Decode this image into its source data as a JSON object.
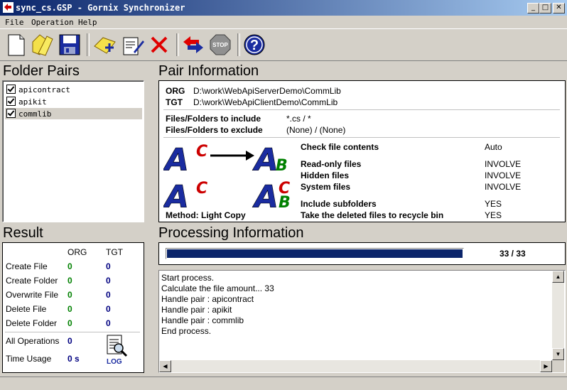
{
  "window": {
    "title": "sync_cs.GSP - Gornix Synchronizer"
  },
  "window_controls": {
    "minimize": "_",
    "maximize": "□",
    "close": "✕"
  },
  "menu": [
    "File",
    "Operation",
    "Help"
  ],
  "toolbar": {
    "icons": [
      "new-file-icon",
      "open-folder-icon",
      "save-icon",
      "add-pair-icon",
      "edit-pair-icon",
      "delete-icon",
      "synchronize-icon",
      "stop-icon",
      "help-icon"
    ],
    "stop_label": "STOP",
    "help_label": "?"
  },
  "folder_pairs": {
    "heading": "Folder Pairs",
    "items": [
      {
        "label": "apicontract",
        "checked": true,
        "selected": false
      },
      {
        "label": "apikit",
        "checked": true,
        "selected": false
      },
      {
        "label": "commlib",
        "checked": true,
        "selected": true
      }
    ]
  },
  "pair_info": {
    "heading": "Pair Information",
    "org_label": "ORG",
    "org_path": "D:\\work\\WebApiServerDemo\\CommLib",
    "tgt_label": "TGT",
    "tgt_path": "D:\\work\\WebApiClientDemo\\CommLib",
    "include_label": "Files/Folders to include",
    "include_value": "*.cs / *",
    "exclude_label": "Files/Folders to exclude",
    "exclude_value": "(None) / (None)",
    "method": "Method: Light Copy",
    "diagram": {
      "a": "A",
      "b": "B",
      "c": "C"
    },
    "options": [
      {
        "label": "Check file contents",
        "value": "Auto"
      },
      {
        "label": "Read-only files",
        "value": "INVOLVE"
      },
      {
        "label": "Hidden files",
        "value": "INVOLVE"
      },
      {
        "label": "System files",
        "value": "INVOLVE"
      },
      {
        "label": "Include subfolders",
        "value": "YES"
      },
      {
        "label": "Take the deleted files to recycle bin",
        "value": "YES"
      }
    ]
  },
  "result": {
    "heading": "Result",
    "col_org": "ORG",
    "col_tgt": "TGT",
    "rows": [
      {
        "label": "Create File",
        "org": "0",
        "tgt": "0"
      },
      {
        "label": "Create Folder",
        "org": "0",
        "tgt": "0"
      },
      {
        "label": "Overwrite File",
        "org": "0",
        "tgt": "0"
      },
      {
        "label": "Delete File",
        "org": "0",
        "tgt": "0"
      },
      {
        "label": "Delete Folder",
        "org": "0",
        "tgt": "0"
      }
    ],
    "all_ops_label": "All Operations",
    "all_ops_value": "0",
    "time_label": "Time Usage",
    "time_value": "0 s",
    "log_label": "LOG"
  },
  "processing": {
    "heading": "Processing Information",
    "progress_text": "33 / 33",
    "progress_fraction": 1.0,
    "log_lines": [
      "Start process.",
      "Calculate the file amount... 33",
      "Handle pair : apicontract",
      "Handle pair : apikit",
      "Handle pair : commlib",
      "End process."
    ]
  },
  "colors": {
    "titlebar_start": "#0a246a",
    "progress": "#0a246a",
    "green": "#008000",
    "red": "#cc0000"
  }
}
